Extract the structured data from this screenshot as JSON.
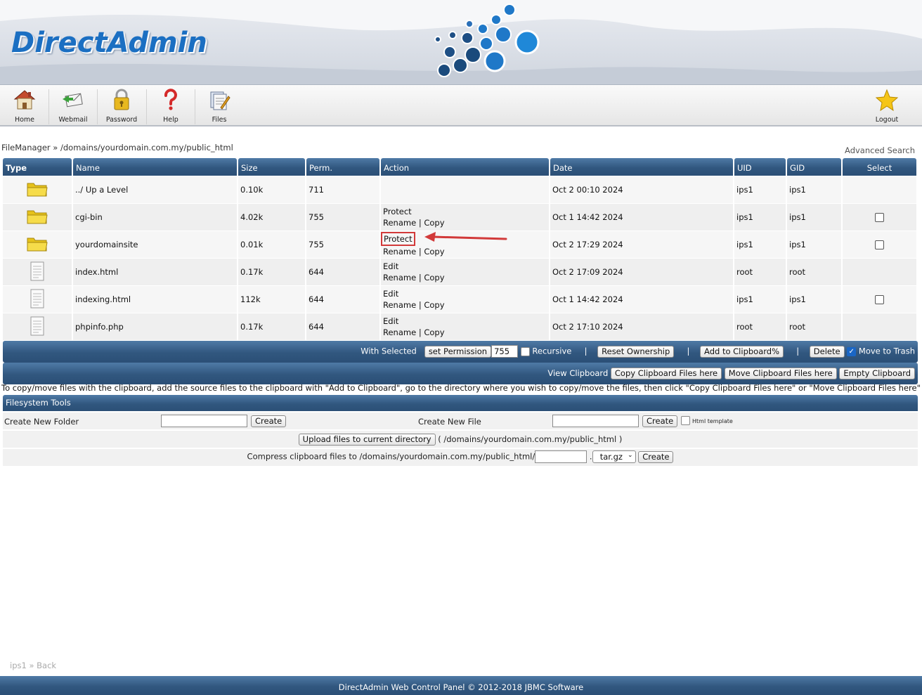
{
  "app": {
    "logo": "DirectAdmin"
  },
  "toolbar": {
    "home": "Home",
    "webmail": "Webmail",
    "password": "Password",
    "help": "Help",
    "files": "Files",
    "logout": "Logout"
  },
  "breadcrumb": {
    "text": "FileManager » /domains/yourdomain.com.my/public_html"
  },
  "advanced_search": "Advanced Search",
  "table": {
    "headers": {
      "type": "Type",
      "name": "Name",
      "size": "Size",
      "perm": "Perm.",
      "action": "Action",
      "date": "Date",
      "uid": "UID",
      "gid": "GID",
      "select": "Select"
    },
    "rows": [
      {
        "icon": "folder-icon",
        "name": "../ Up a Level",
        "size": "0.10k",
        "perm": "711",
        "action1": "",
        "rename": "",
        "copy": "",
        "date": "Oct 2 00:10 2024",
        "uid": "ips1",
        "gid": "ips1",
        "checkbox": false
      },
      {
        "icon": "folder-icon",
        "name": "cgi-bin",
        "size": "4.02k",
        "perm": "755",
        "action1": "Protect",
        "rename": "Rename",
        "copy": "Copy",
        "date": "Oct 1 14:42 2024",
        "uid": "ips1",
        "gid": "ips1",
        "checkbox": true
      },
      {
        "icon": "folder-icon",
        "name": "yourdomainsite",
        "size": "0.01k",
        "perm": "755",
        "action1": "Protect",
        "rename": "Rename",
        "copy": "Copy",
        "date": "Oct 2 17:29 2024",
        "uid": "ips1",
        "gid": "ips1",
        "checkbox": true
      },
      {
        "icon": "file-icon",
        "name": "index.html",
        "size": "0.17k",
        "perm": "644",
        "action1": "Edit",
        "rename": "Rename",
        "copy": "Copy",
        "date": "Oct 2 17:09 2024",
        "uid": "root",
        "gid": "root",
        "checkbox": false
      },
      {
        "icon": "file-icon",
        "name": "indexing.html",
        "size": "112k",
        "perm": "644",
        "action1": "Edit",
        "rename": "Rename",
        "copy": "Copy",
        "date": "Oct 1 14:42 2024",
        "uid": "ips1",
        "gid": "ips1",
        "checkbox": true
      },
      {
        "icon": "file-icon",
        "name": "phpinfo.php",
        "size": "0.17k",
        "perm": "644",
        "action1": "Edit",
        "rename": "Rename",
        "copy": "Copy",
        "date": "Oct 2 17:10 2024",
        "uid": "root",
        "gid": "root",
        "checkbox": false
      }
    ]
  },
  "selected_bar": {
    "with_selected": "With Selected",
    "set_permission": "set Permission",
    "permission_value": "755",
    "recursive": "Recursive",
    "reset_ownership": "Reset Ownership",
    "add_to_clipboard": "Add to Clipboard%",
    "delete": "Delete",
    "move_to_trash": "Move to Trash"
  },
  "clipboard_bar": {
    "view_clipboard": "View Clipboard",
    "copy_here": "Copy Clipboard Files here",
    "move_here": "Move Clipboard Files here",
    "empty": "Empty Clipboard"
  },
  "note": "To copy/move files with the clipboard, add the source files to the clipboard with \"Add to Clipboard\", go to the directory where you wish to copy/move the files, then click \"Copy Clipboard Files here\" or \"Move Clipboard Files here\"",
  "fs_tools": {
    "title": "Filesystem Tools",
    "new_folder_label": "Create New Folder",
    "new_file_label": "Create New File",
    "create": "Create",
    "html_template": "Html template",
    "upload_button": "Upload files to current directory",
    "upload_path": "( /domains/yourdomain.com.my/public_html )",
    "compress_label": "Compress clipboard files to /domains/yourdomain.com.my/public_html/",
    "compress_ext": "tar.gz",
    "dot": "."
  },
  "bottom_crumb": {
    "user": "ips1",
    "sep": "»",
    "back": "Back"
  },
  "footer": "DirectAdmin Web Control Panel © 2012-2018 JBMC Software",
  "colors": {
    "header_blue": "#2b4f76",
    "logo_blue": "#1b6fc2",
    "highlight_red": "#d23a3a"
  }
}
